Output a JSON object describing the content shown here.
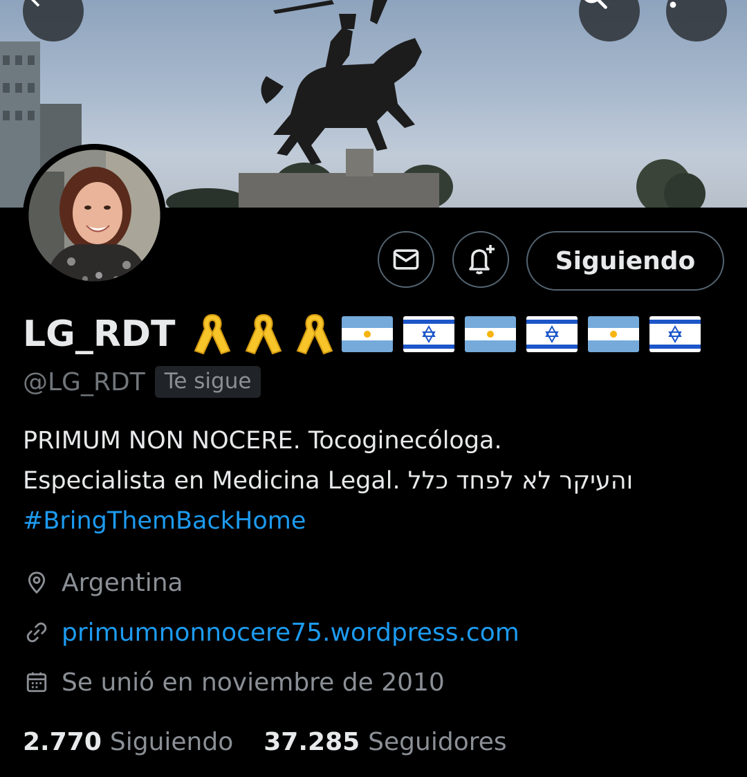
{
  "profile": {
    "display_name": "LG_RDT",
    "handle": "@LG_RDT",
    "follows_you_badge": "Te sigue",
    "emoji": [
      "yellow-ribbon",
      "yellow-ribbon",
      "yellow-ribbon",
      "flag-argentina",
      "flag-israel",
      "flag-argentina",
      "flag-israel",
      "flag-argentina",
      "flag-israel"
    ]
  },
  "actions": {
    "message_icon": "mail-icon",
    "notify_icon": "bell-plus-icon",
    "follow_label": "Siguiendo"
  },
  "header": {
    "back_icon": "arrow-left-icon",
    "search_icon": "search-icon",
    "more_icon": "more-vertical-icon"
  },
  "bio": {
    "line1": "PRIMUM NON NOCERE. Tocoginecóloga.",
    "line2": "Especialista en Medicina Legal. והעיקר לא לפחד כלל",
    "hashtag": "#BringThemBackHome"
  },
  "meta": {
    "location": "Argentina",
    "website": "primumnonnocere75.wordpress.com",
    "joined": "Se unió en noviembre de 2010"
  },
  "stats": {
    "following_count": "2.770",
    "following_label": "Siguiendo",
    "followers_count": "37.285",
    "followers_label": "Seguidores"
  },
  "colors": {
    "background": "#000000",
    "text_primary": "#e7e9ea",
    "text_secondary": "#71767b",
    "link": "#1d9bf0",
    "border": "#536471"
  }
}
